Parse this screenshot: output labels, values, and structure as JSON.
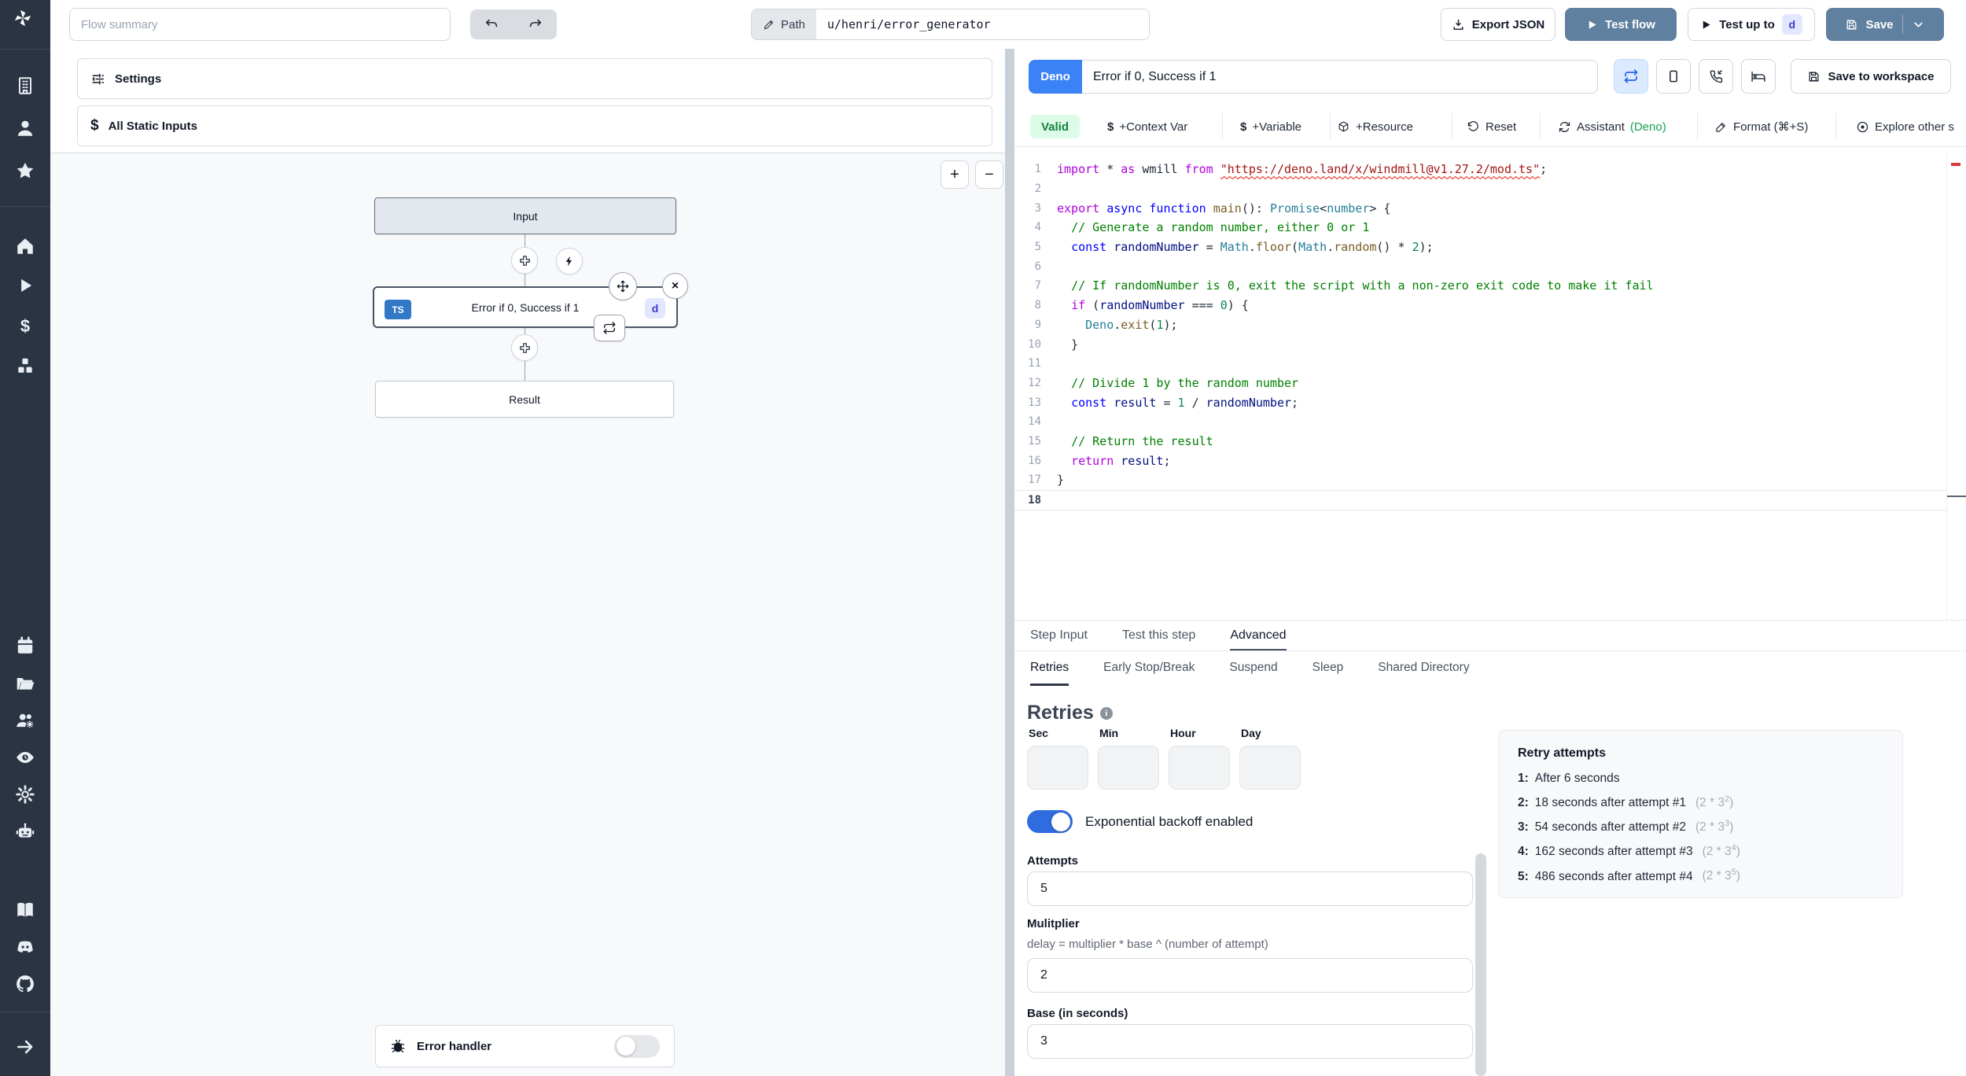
{
  "colors": {
    "sidebar_bg": "#2b3442",
    "accent_blue": "#60809f",
    "deno_badge_blue": "#3b82f6",
    "ts_badge_blue": "#3178c6",
    "id_badge_bg": "#e0e7ff",
    "id_badge_text": "#4338ca",
    "valid_bg": "#dcfce7",
    "valid_text": "#15803d",
    "toggle_on_blue": "#2e6cdf"
  },
  "sidebar": {
    "icons": [
      "windmill-logo",
      "building",
      "user",
      "star",
      "home",
      "play",
      "dollar",
      "cubes",
      "calendar",
      "folder-open",
      "users-settings",
      "eye",
      "gear",
      "robot",
      "book",
      "discord",
      "github",
      "collapse-arrow"
    ]
  },
  "topbar": {
    "flow_summary_placeholder": "Flow summary",
    "path_label": "Path",
    "path_value": "u/henri/error_generator",
    "export_json": "Export JSON",
    "test_flow": "Test flow",
    "test_up_to": "Test up to",
    "test_up_to_badge": "d",
    "save": "Save"
  },
  "flow": {
    "settings_label": "Settings",
    "static_inputs_label": "All Static Inputs",
    "zoom_in": "+",
    "zoom_out": "−",
    "input_node": "Input",
    "step_node": {
      "lang": "TS",
      "label": "Error if 0, Success if 1",
      "id_badge": "d"
    },
    "result_node": "Result",
    "error_handler_label": "Error handler"
  },
  "editor": {
    "lang_badge": "Deno",
    "step_name": "Error if 0, Success if 1",
    "save_to_workspace": "Save to workspace",
    "toolbar": {
      "valid": "Valid",
      "context_var": "+Context Var",
      "variable": "+Variable",
      "resource": "+Resource",
      "reset": "Reset",
      "assistant": "Assistant",
      "assistant_lang": "(Deno)",
      "format": "Format (⌘+S)",
      "explore": "Explore other s"
    },
    "code_lines": [
      {
        "n": 1,
        "tokens": [
          {
            "c": "kw1",
            "t": "import"
          },
          {
            "c": "pl",
            "t": " * "
          },
          {
            "c": "kw1",
            "t": "as"
          },
          {
            "c": "pl",
            "t": " wmill "
          },
          {
            "c": "kw1",
            "t": "from"
          },
          {
            "c": "pl",
            "t": " "
          },
          {
            "c": "str",
            "t": "\"https://deno.land/x/windmill@v1.27.2/mod.ts\"",
            "sq": true
          },
          {
            "c": "pl",
            "t": ";"
          }
        ]
      },
      {
        "n": 2,
        "tokens": []
      },
      {
        "n": 3,
        "tokens": [
          {
            "c": "kw1",
            "t": "export"
          },
          {
            "c": "pl",
            "t": " "
          },
          {
            "c": "kw2",
            "t": "async"
          },
          {
            "c": "pl",
            "t": " "
          },
          {
            "c": "kw2",
            "t": "function"
          },
          {
            "c": "pl",
            "t": " "
          },
          {
            "c": "fn",
            "t": "main"
          },
          {
            "c": "pl",
            "t": "(): "
          },
          {
            "c": "ty",
            "t": "Promise"
          },
          {
            "c": "pl",
            "t": "<"
          },
          {
            "c": "ty",
            "t": "number"
          },
          {
            "c": "pl",
            "t": "> {"
          }
        ]
      },
      {
        "n": 4,
        "tokens": [
          {
            "c": "pl",
            "t": "  "
          },
          {
            "c": "com",
            "t": "// Generate a random number, either 0 or 1"
          }
        ]
      },
      {
        "n": 5,
        "tokens": [
          {
            "c": "pl",
            "t": "  "
          },
          {
            "c": "kw2",
            "t": "const"
          },
          {
            "c": "pl",
            "t": " "
          },
          {
            "c": "var",
            "t": "randomNumber"
          },
          {
            "c": "pl",
            "t": " = "
          },
          {
            "c": "ty",
            "t": "Math"
          },
          {
            "c": "pl",
            "t": "."
          },
          {
            "c": "fn",
            "t": "floor"
          },
          {
            "c": "pl",
            "t": "("
          },
          {
            "c": "ty",
            "t": "Math"
          },
          {
            "c": "pl",
            "t": "."
          },
          {
            "c": "fn",
            "t": "random"
          },
          {
            "c": "pl",
            "t": "() * "
          },
          {
            "c": "num",
            "t": "2"
          },
          {
            "c": "pl",
            "t": ");"
          }
        ]
      },
      {
        "n": 6,
        "tokens": []
      },
      {
        "n": 7,
        "tokens": [
          {
            "c": "pl",
            "t": "  "
          },
          {
            "c": "com",
            "t": "// If randomNumber is 0, exit the script with a non-zero exit code to make it fail"
          }
        ]
      },
      {
        "n": 8,
        "tokens": [
          {
            "c": "pl",
            "t": "  "
          },
          {
            "c": "kw1",
            "t": "if"
          },
          {
            "c": "pl",
            "t": " ("
          },
          {
            "c": "var",
            "t": "randomNumber"
          },
          {
            "c": "pl",
            "t": " === "
          },
          {
            "c": "num",
            "t": "0"
          },
          {
            "c": "pl",
            "t": ") {"
          }
        ]
      },
      {
        "n": 9,
        "tokens": [
          {
            "c": "pl",
            "t": "    "
          },
          {
            "c": "ty",
            "t": "Deno"
          },
          {
            "c": "pl",
            "t": "."
          },
          {
            "c": "fn",
            "t": "exit"
          },
          {
            "c": "pl",
            "t": "("
          },
          {
            "c": "num",
            "t": "1"
          },
          {
            "c": "pl",
            "t": ");"
          }
        ]
      },
      {
        "n": 10,
        "tokens": [
          {
            "c": "pl",
            "t": "  }"
          }
        ]
      },
      {
        "n": 11,
        "tokens": []
      },
      {
        "n": 12,
        "tokens": [
          {
            "c": "pl",
            "t": "  "
          },
          {
            "c": "com",
            "t": "// Divide 1 by the random number"
          }
        ]
      },
      {
        "n": 13,
        "tokens": [
          {
            "c": "pl",
            "t": "  "
          },
          {
            "c": "kw2",
            "t": "const"
          },
          {
            "c": "pl",
            "t": " "
          },
          {
            "c": "var",
            "t": "result"
          },
          {
            "c": "pl",
            "t": " = "
          },
          {
            "c": "num",
            "t": "1"
          },
          {
            "c": "pl",
            "t": " / "
          },
          {
            "c": "var",
            "t": "randomNumber"
          },
          {
            "c": "pl",
            "t": ";"
          }
        ]
      },
      {
        "n": 14,
        "tokens": []
      },
      {
        "n": 15,
        "tokens": [
          {
            "c": "pl",
            "t": "  "
          },
          {
            "c": "com",
            "t": "// Return the result"
          }
        ]
      },
      {
        "n": 16,
        "tokens": [
          {
            "c": "pl",
            "t": "  "
          },
          {
            "c": "kw1",
            "t": "return"
          },
          {
            "c": "pl",
            "t": " "
          },
          {
            "c": "var",
            "t": "result"
          },
          {
            "c": "pl",
            "t": ";"
          }
        ]
      },
      {
        "n": 17,
        "tokens": [
          {
            "c": "pl",
            "t": "}"
          }
        ]
      },
      {
        "n": 18,
        "tokens": [],
        "active": true
      }
    ]
  },
  "bottom": {
    "tabs": [
      {
        "label": "Step Input",
        "active": false
      },
      {
        "label": "Test this step",
        "active": false
      },
      {
        "label": "Advanced",
        "active": true
      }
    ],
    "subtabs": [
      {
        "label": "Retries",
        "active": true
      },
      {
        "label": "Early Stop/Break",
        "active": false
      },
      {
        "label": "Suspend",
        "active": false
      },
      {
        "label": "Sleep",
        "active": false
      },
      {
        "label": "Shared Directory",
        "active": false
      }
    ],
    "retries": {
      "title": "Retries",
      "time_labels": [
        "Sec",
        "Min",
        "Hour",
        "Day"
      ],
      "backoff_label": "Exponential backoff enabled",
      "attempts_label": "Attempts",
      "attempts_value": "5",
      "multiplier_label": "Mulitplier",
      "multiplier_help": "delay = multiplier * base ^ (number of attempt)",
      "multiplier_value": "2",
      "base_label": "Base (in seconds)",
      "base_value": "3",
      "retry_attempts": {
        "title": "Retry attempts",
        "items": [
          {
            "n": "1:",
            "text": "After 6 seconds"
          },
          {
            "n": "2:",
            "text": "18 seconds after attempt #1",
            "formula_base": "2 * 3",
            "formula_exp": "2"
          },
          {
            "n": "3:",
            "text": "54 seconds after attempt #2",
            "formula_base": "2 * 3",
            "formula_exp": "3"
          },
          {
            "n": "4:",
            "text": "162 seconds after attempt #3",
            "formula_base": "2 * 3",
            "formula_exp": "4"
          },
          {
            "n": "5:",
            "text": "486 seconds after attempt #4",
            "formula_base": "2 * 3",
            "formula_exp": "5"
          }
        ]
      }
    }
  }
}
